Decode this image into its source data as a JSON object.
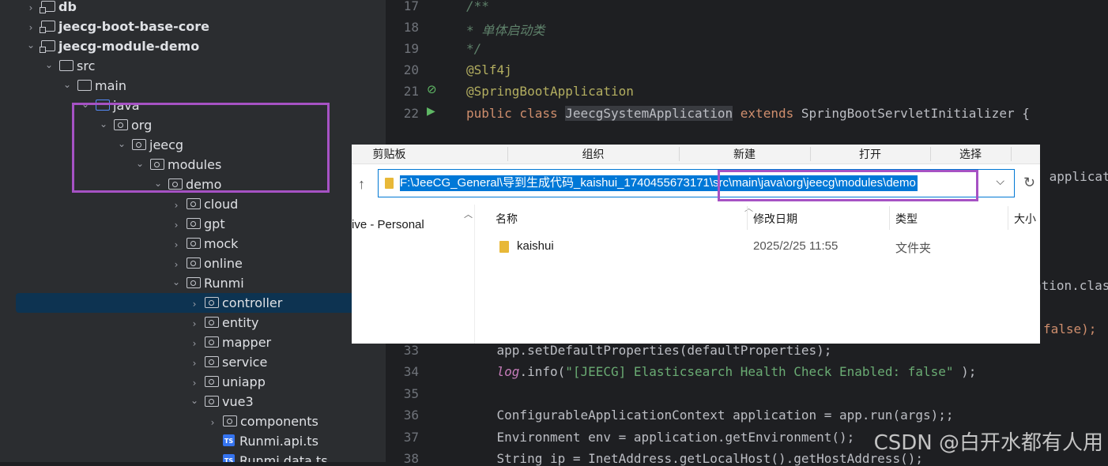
{
  "tree": {
    "items": [
      {
        "label": "db",
        "level": 1,
        "type": "module",
        "expanded": false
      },
      {
        "label": "jeecg-boot-base-core",
        "level": 1,
        "type": "module",
        "expanded": false
      },
      {
        "label": "jeecg-module-demo",
        "level": 1,
        "type": "module",
        "expanded": true
      },
      {
        "label": "src",
        "level": 2,
        "type": "folder",
        "expanded": true
      },
      {
        "label": "main",
        "level": 3,
        "type": "folder",
        "expanded": true
      },
      {
        "label": "java",
        "level": 4,
        "type": "source",
        "expanded": true
      },
      {
        "label": "org",
        "level": 5,
        "type": "package",
        "expanded": true
      },
      {
        "label": "jeecg",
        "level": 6,
        "type": "package",
        "expanded": true
      },
      {
        "label": "modules",
        "level": 7,
        "type": "package",
        "expanded": true
      },
      {
        "label": "demo",
        "level": 8,
        "type": "package",
        "expanded": true
      },
      {
        "label": "cloud",
        "level": 9,
        "type": "package",
        "expanded": false
      },
      {
        "label": "gpt",
        "level": 9,
        "type": "package",
        "expanded": false
      },
      {
        "label": "mock",
        "level": 9,
        "type": "package",
        "expanded": false
      },
      {
        "label": "online",
        "level": 9,
        "type": "package",
        "expanded": false
      },
      {
        "label": "Runmi",
        "level": 9,
        "type": "package",
        "expanded": true
      },
      {
        "label": "controller",
        "level": 10,
        "type": "package",
        "expanded": false
      },
      {
        "label": "entity",
        "level": 10,
        "type": "package",
        "expanded": false
      },
      {
        "label": "mapper",
        "level": 10,
        "type": "package",
        "expanded": false
      },
      {
        "label": "service",
        "level": 10,
        "type": "package",
        "expanded": false
      },
      {
        "label": "uniapp",
        "level": 10,
        "type": "package",
        "expanded": false
      },
      {
        "label": "vue3",
        "level": 10,
        "type": "package",
        "expanded": true
      },
      {
        "label": "components",
        "level": 11,
        "type": "package",
        "expanded": false
      },
      {
        "label": "Runmi.api.ts",
        "level": 11,
        "type": "ts",
        "expanded": null
      },
      {
        "label": "Runmi.data.ts",
        "level": 11,
        "type": "ts",
        "expanded": null
      }
    ],
    "selected": "controller"
  },
  "editor": {
    "lines": [
      {
        "num": "17",
        "text": "/**",
        "style": "cmt"
      },
      {
        "num": "18",
        "text": "* 单体启动类",
        "style": "cmt"
      },
      {
        "num": "19",
        "text": "*/",
        "style": "cmt"
      },
      {
        "num": "20",
        "text": "@Slf4j",
        "style": "ann"
      },
      {
        "num": "21",
        "text": "@SpringBootApplication",
        "style": "ann"
      },
      {
        "num": "22",
        "text": "",
        "style": "class_decl"
      },
      {
        "num": "33",
        "text": "",
        "style": "line33"
      },
      {
        "num": "34",
        "text": "",
        "style": "line34"
      },
      {
        "num": "35",
        "text": "",
        "style": "plain"
      },
      {
        "num": "36",
        "text": "    ConfigurableApplicationContext application = app.run(args);;",
        "style": "plain"
      },
      {
        "num": "37",
        "text": "    Environment env = application.getEnvironment();",
        "style": "plain"
      },
      {
        "num": "38",
        "text": "    String ip = InetAddress.getLocalHost().getHostAddress();",
        "style": "plain"
      }
    ],
    "class_decl": {
      "kw1": "public class ",
      "name": "JeecgSystemApplication",
      "kw2": " extends ",
      "rest": "SpringBootServletInitializer {"
    },
    "line33": "    app.setDefaultProperties(defaultProperties);",
    "line34": {
      "pre": "    ",
      "field": "log",
      "mid": ".info(",
      "str": "\"[JEECG] Elasticsearch Health Check Enabled: false\"",
      "end": " );"
    },
    "peek_right": [
      " applicat",
      "ation.clas",
      "false);"
    ]
  },
  "explorer": {
    "ribbon": [
      "剪贴板",
      "组织",
      "新建",
      "打开",
      "选择"
    ],
    "address": "F:\\JeeCG_General\\导到生成代码_kaishui_1740455673171\\src\\main\\java\\org\\jeecg\\modules\\demo",
    "nav_item": "ive - Personal",
    "columns": [
      "名称",
      "修改日期",
      "类型",
      "大小"
    ],
    "rows": [
      {
        "name": "kaishui",
        "date": "2025/2/25 11:55",
        "type": "文件夹",
        "size": ""
      }
    ]
  },
  "watermark": "CSDN @白开水都有人用",
  "colors": {
    "highlight_box": "#a652c4",
    "selection": "#0078d7",
    "tree_selected": "#0d3351"
  }
}
